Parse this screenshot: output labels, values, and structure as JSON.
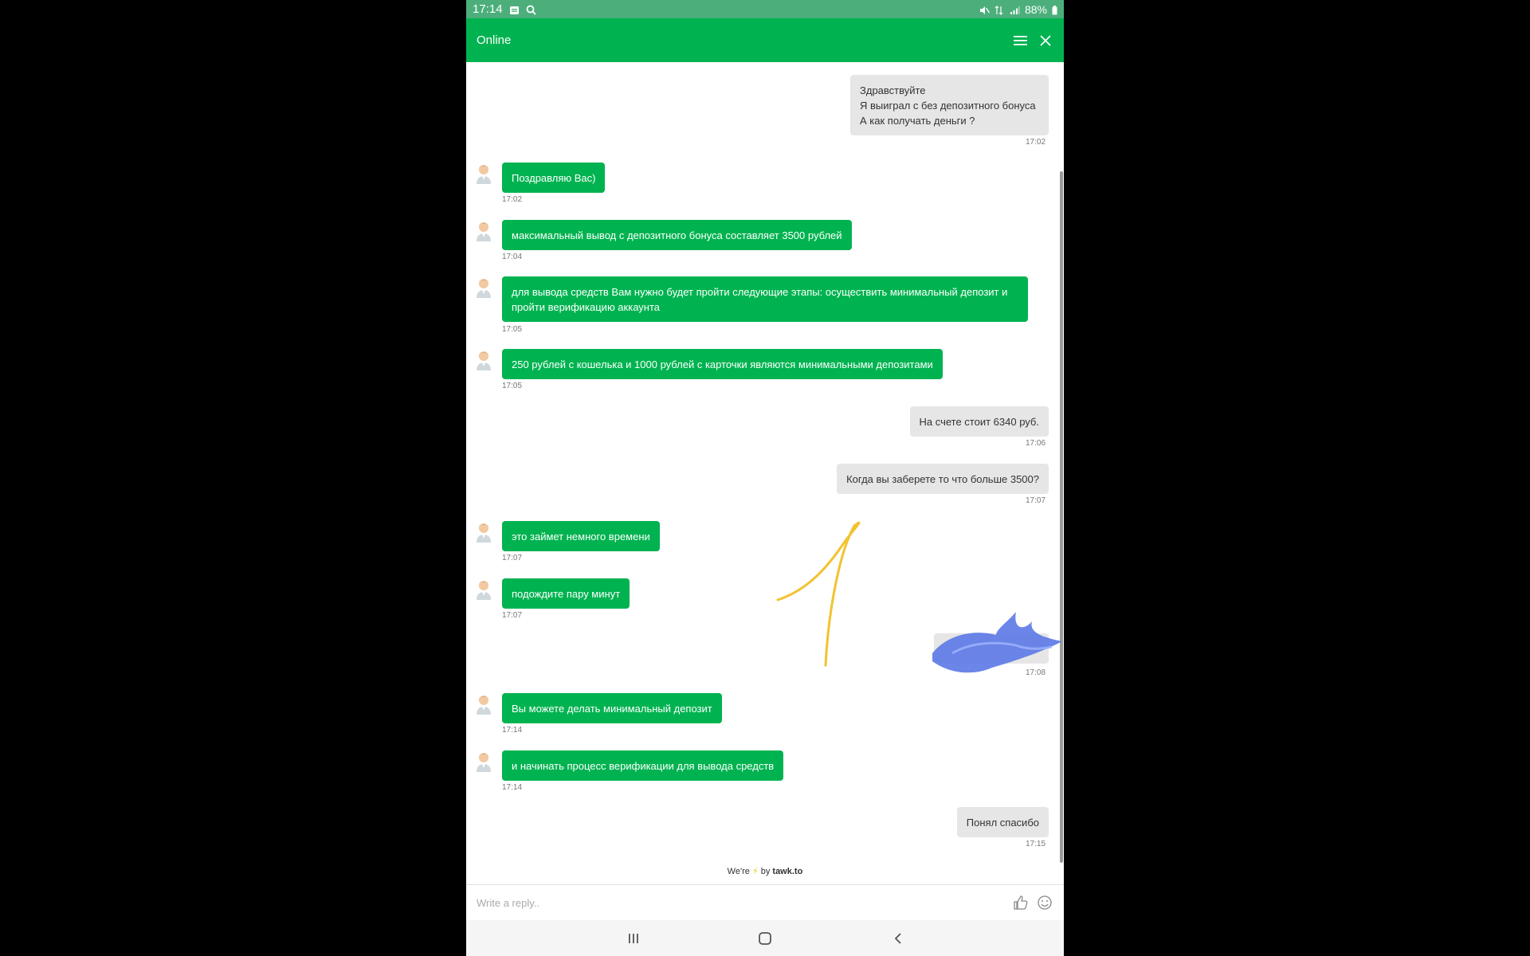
{
  "status_bar": {
    "time": "17:14",
    "battery": "88%"
  },
  "header": {
    "title": "Online",
    "menu_icon": "menu-icon",
    "close_icon": "close-icon"
  },
  "messages": [
    {
      "from": "visitor",
      "lines": [
        "Здравствуйте",
        "Я выиграл с без депозитного бонуса",
        "А как получать деньги ?"
      ],
      "time": "17:02"
    },
    {
      "from": "agent",
      "lines": [
        "Поздравляю Вас)"
      ],
      "time": "17:02"
    },
    {
      "from": "agent",
      "lines": [
        "максимальный вывод с депозитного бонуса составляет 3500 рублей"
      ],
      "time": "17:04"
    },
    {
      "from": "agent",
      "lines": [
        "для вывода средств Вам нужно будет пройти следующие этапы:  осуществить минимальный депозит и",
        "пройти верификацию аккаунта"
      ],
      "time": "17:05"
    },
    {
      "from": "agent",
      "lines": [
        "250 рублей с кошелька и 1000 рублей с карточки являются минимальными депозитами"
      ],
      "time": "17:05"
    },
    {
      "from": "visitor",
      "lines": [
        "На счете стоит 6340 руб."
      ],
      "time": "17:06"
    },
    {
      "from": "visitor",
      "lines": [
        "Когда вы заберете то что больше 3500?"
      ],
      "time": "17:07"
    },
    {
      "from": "agent",
      "lines": [
        "это займет немного времени"
      ],
      "time": "17:07"
    },
    {
      "from": "agent",
      "lines": [
        "подождите пару минут"
      ],
      "time": "17:07"
    },
    {
      "from": "visitor",
      "lines": [
        ""
      ],
      "time": "17:08"
    },
    {
      "from": "agent",
      "lines": [
        "Вы можете делать минимальный депозит"
      ],
      "time": "17:14"
    },
    {
      "from": "agent",
      "lines": [
        "и начинать процесс верификации для вывода средств"
      ],
      "time": "17:14"
    },
    {
      "from": "visitor",
      "lines": [
        "Понял спасибо"
      ],
      "time": "17:15"
    }
  ],
  "footer": {
    "powered_prefix": "We're",
    "powered_by": "by",
    "brand": "tawk.to",
    "reply_placeholder": "Write a reply..",
    "like_icon": "thumbs-up-icon",
    "emoji_icon": "emoji-icon"
  },
  "colors": {
    "accent": "#00b350",
    "status_bar": "#4caf7b",
    "visitor_bubble": "#e6e6e6"
  }
}
